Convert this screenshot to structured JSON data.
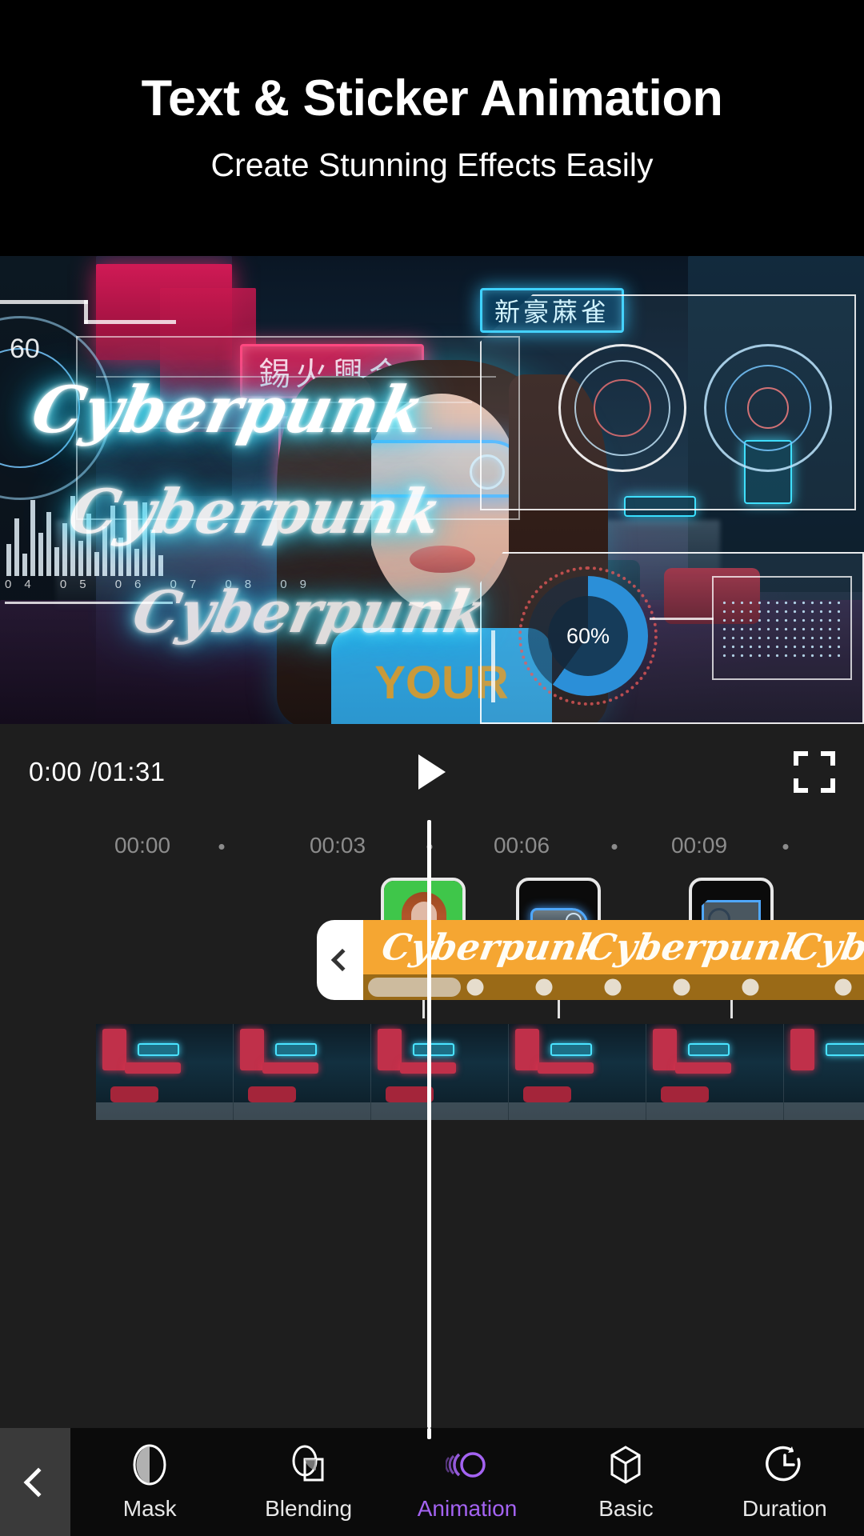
{
  "header": {
    "title": "Text & Sticker Animation",
    "subtitle": "Create Stunning Effects Easily"
  },
  "preview": {
    "neon_texts": [
      "Cyberpunk",
      "Cyberpunk",
      "Cyberpunk"
    ],
    "hud_left_label": "60",
    "hud_gauge_value": "60%",
    "hud_axis_labels": [
      "04",
      "05",
      "06",
      "07",
      "08",
      "09"
    ],
    "neon_signs": [
      {
        "text": "錫火興合",
        "color": "#ff3f7a"
      },
      {
        "text": "新豪蔴雀",
        "color": "#3fd2ff"
      }
    ],
    "shirt_text": "YOUR",
    "accent_neon": "#29d6ff"
  },
  "player": {
    "current_time": "0:00",
    "separator": "/",
    "total_time": "01:31",
    "time_display": "0:00 /01:31",
    "play_icon": "play-icon",
    "fullscreen_icon": "fullscreen-icon"
  },
  "timeline": {
    "ruler_labels": [
      "00:00",
      "00:03",
      "00:06",
      "00:09"
    ],
    "playhead_time": "00:04",
    "stickers": [
      {
        "name": "portrait-sticker",
        "icon": "portrait-green-screen"
      },
      {
        "name": "goggles-sticker",
        "icon": "neon-goggles"
      },
      {
        "name": "hud-panel-sticker",
        "icon": "blue-hud-panel"
      }
    ],
    "text_track": {
      "label": "Cyberpunk",
      "repeats": [
        "Cyberpunk",
        "Cyberpunk",
        "Cyberpunk",
        "Cyberpunk"
      ],
      "color": "#f5a632",
      "keyframe_row_color": "#9a6a17",
      "keyframe_count": 6,
      "collapse_icon": "chevron-left-icon"
    }
  },
  "toolbar": {
    "back_icon": "chevron-left-icon",
    "active_color": "#a463f2",
    "items": [
      {
        "label": "Mask",
        "icon": "mask-icon",
        "active": false
      },
      {
        "label": "Blending",
        "icon": "blending-icon",
        "active": false
      },
      {
        "label": "Animation",
        "icon": "animation-icon",
        "active": true
      },
      {
        "label": "Basic",
        "icon": "basic-cube-icon",
        "active": false
      },
      {
        "label": "Duration",
        "icon": "duration-clock-icon",
        "active": false
      }
    ]
  }
}
